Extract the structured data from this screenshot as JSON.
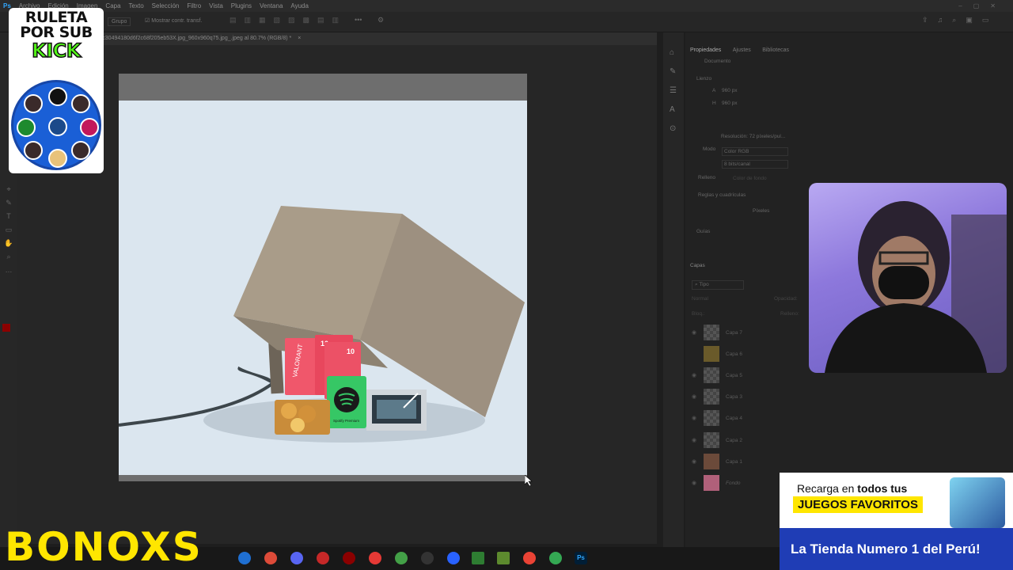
{
  "menu": [
    "Archivo",
    "Edición",
    "Imagen",
    "Capa",
    "Texto",
    "Selección",
    "Filtro",
    "Vista",
    "Plugins",
    "Ventana",
    "Ayuda"
  ],
  "options": {
    "group": "Grupo",
    "transform": "Mostrar contr. transf."
  },
  "document_tab": "8ecc30494180d6f2c68f205eb53X.jpg_960x960q75.jpg_.jpeg al 80.7% (RGB/8) *",
  "panel": {
    "tabs": [
      "Propiedades",
      "Ajustes",
      "Bibliotecas"
    ],
    "doc_label": "Documento",
    "canvas_section": "Lienzo",
    "width_label": "A",
    "width": "960 px",
    "height_label": "H",
    "height": "960 px",
    "resolution": "Resolución: 72 píxeles/pul...",
    "mode_label": "Modo",
    "mode": "Color RGB",
    "bits": "8 bits/canal",
    "fill_label": "Relleno",
    "fill": "Color de fondo",
    "rulers_section": "Reglas y cuadrículas",
    "rulers_unit": "Píxeles",
    "guides_section": "Guías",
    "layers_title": "Capas",
    "layers_filter": "Tipo",
    "blend_mode": "Normal",
    "opacity_label": "Opacidad:",
    "lock_label": "Bloq.:",
    "fill2_label": "Relleno:",
    "layers": [
      "Capa 7",
      "Capa 6",
      "Capa 5",
      "Capa 3",
      "Capa 4",
      "Capa 2",
      "Capa 1",
      "Fondo"
    ]
  },
  "overlay": {
    "roulette_line1": "RULETA",
    "roulette_line2": "POR SUB",
    "roulette_line3": "KICK",
    "brand": "BONOXS",
    "ad_line1_a": "Recarga en ",
    "ad_line1_b": "todos tus",
    "ad_line2": "JUEGOS FAVORITOS",
    "ad_line3": "La Tienda Numero 1 del Perú!"
  },
  "artwork": {
    "card_label": "VALORANT",
    "card_value": "10",
    "spotify_label": "Spotify Premium"
  },
  "colors": {
    "accent": "#ffe600",
    "kick": "#53fc18",
    "wheel": "#1a5fd6",
    "ad_blue": "#1f3db5"
  }
}
